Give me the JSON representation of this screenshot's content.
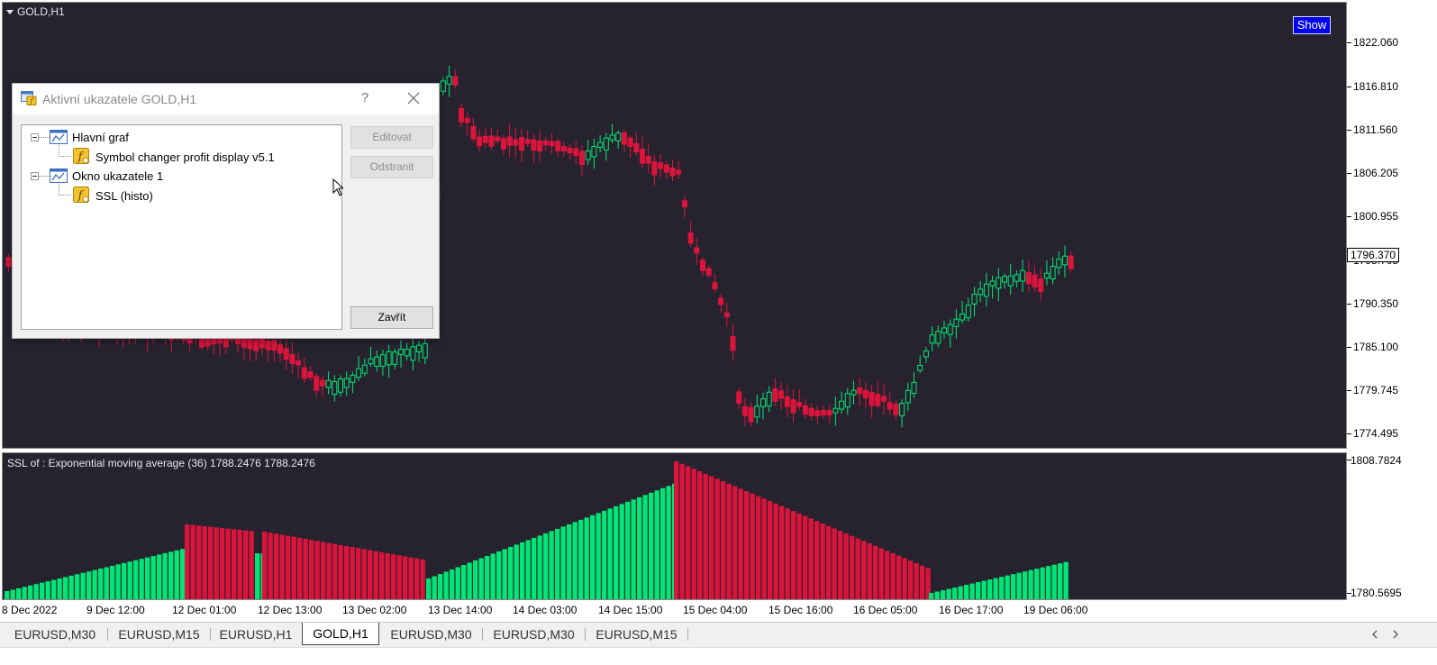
{
  "main_chart": {
    "symbol_title": "GOLD,H1",
    "show_label": "Show",
    "price_labels": [
      "1822.060",
      "1816.810",
      "1811.560",
      "1806.205",
      "1800.955",
      "1795.705",
      "1790.350",
      "1785.100",
      "1779.745",
      "1774.495"
    ],
    "current_price": "1796.370"
  },
  "sub_chart": {
    "title": "SSL of : Exponential moving average (36)  1788.2476 1788.2476",
    "price_labels": [
      "1808.7824",
      "1780.5695"
    ]
  },
  "time_axis": {
    "labels": [
      "8 Dec 2022",
      "9 Dec 12:00",
      "12 Dec 01:00",
      "12 Dec 13:00",
      "13 Dec 02:00",
      "13 Dec 14:00",
      "14 Dec 03:00",
      "14 Dec 15:00",
      "15 Dec 04:00",
      "15 Dec 16:00",
      "16 Dec 05:00",
      "16 Dec 17:00",
      "19 Dec 06:00"
    ]
  },
  "dialog": {
    "title": "Aktivní ukazatele GOLD,H1",
    "help": "?",
    "tree": [
      {
        "label": "Hlavní graf",
        "children": [
          {
            "label": "Symbol changer profit display v5.1"
          }
        ]
      },
      {
        "label": "Okno ukazatele 1",
        "children": [
          {
            "label": "SSL  (histo)"
          }
        ]
      }
    ],
    "edit_label": "Editovat",
    "remove_label": "Odstranit",
    "close_label": "Zavřít"
  },
  "tabs": [
    {
      "label": "EURUSD,M30",
      "active": false
    },
    {
      "label": "EURUSD,M15",
      "active": false
    },
    {
      "label": "EURUSD,H1",
      "active": false
    },
    {
      "label": "GOLD,H1",
      "active": true
    },
    {
      "label": "EURUSD,M30",
      "active": false
    },
    {
      "label": "EURUSD,M30",
      "active": false
    },
    {
      "label": "EURUSD,M15",
      "active": false
    }
  ],
  "colors": {
    "background": "#26232f",
    "bull": "#00e676",
    "bear": "#dc143c",
    "show_button": "#0000ee"
  }
}
